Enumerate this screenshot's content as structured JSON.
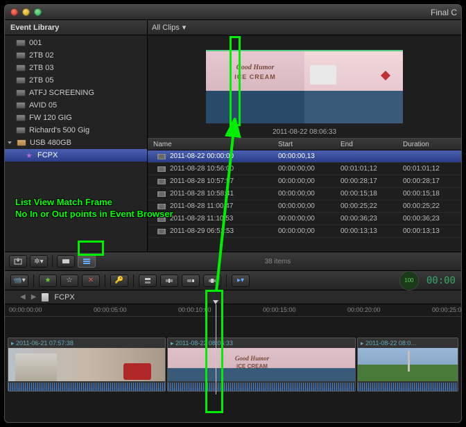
{
  "window": {
    "title": "Final C"
  },
  "library": {
    "header": "Event Library",
    "items": [
      {
        "label": "001",
        "type": "hd"
      },
      {
        "label": "2TB 02",
        "type": "hd"
      },
      {
        "label": "2TB 03",
        "type": "hd"
      },
      {
        "label": "2TB 05",
        "type": "hd"
      },
      {
        "label": "ATFJ SCREENING",
        "type": "hd"
      },
      {
        "label": "AVID 05",
        "type": "hd"
      },
      {
        "label": "FW 120 GIG",
        "type": "hd"
      },
      {
        "label": "Richard's 500 Gig",
        "type": "hd"
      },
      {
        "label": "USB 480GB",
        "type": "usb",
        "disclosure": true
      },
      {
        "label": "FCPX",
        "type": "event",
        "child": true,
        "selected": true
      }
    ]
  },
  "browser": {
    "filter": "All Clips",
    "thumb_label": "2011-08-22 08:06:33",
    "thumb_brand1": "Good Humor",
    "thumb_brand2": "ICE CREAM",
    "columns": {
      "name": "Name",
      "start": "Start",
      "end": "End",
      "duration": "Duration"
    },
    "rows": [
      {
        "name": "2011-08-22 00:00:00",
        "start": "00:00:00,13",
        "end": "",
        "duration": "",
        "selected": true
      },
      {
        "name": "2011-08-28 10:56:00",
        "start": "00:00:00;00",
        "end": "00:01:01;12",
        "duration": "00:01:01;12"
      },
      {
        "name": "2011-08-28 10:57:57",
        "start": "00:00:00;00",
        "end": "00:00:28;17",
        "duration": "00:00:28;17"
      },
      {
        "name": "2011-08-28 10:58:41",
        "start": "00:00:00;00",
        "end": "00:00:15;18",
        "duration": "00:00:15;18"
      },
      {
        "name": "2011-08-28 11:00:47",
        "start": "00:00:00;00",
        "end": "00:00:25;22",
        "duration": "00:00:25;22"
      },
      {
        "name": "2011-08-28 11:10:53",
        "start": "00:00:00;00",
        "end": "00:00:36;23",
        "duration": "00:00:36;23"
      },
      {
        "name": "2011-08-29 06:51:53",
        "start": "00:00:00;00",
        "end": "00:00:13;13",
        "duration": "00:00:13;13"
      }
    ],
    "count": "38 items"
  },
  "timeline": {
    "project": "FCPX",
    "ruler": [
      "00:00:00:00",
      "00:00:05:00",
      "00:00:10:00",
      "00:00:15:00",
      "00:00:20:00",
      "00:00:25:00"
    ],
    "gauge": "100",
    "timecode": "00:00",
    "clips": [
      {
        "label": "2011-06-21 07:57:38"
      },
      {
        "label": "2011-08-22 08:06:33"
      },
      {
        "label": "2011-08-22 08:0…"
      }
    ]
  },
  "annotation": {
    "line1": "List View Match Frame",
    "line2": "No In or Out points in Event Browser"
  }
}
